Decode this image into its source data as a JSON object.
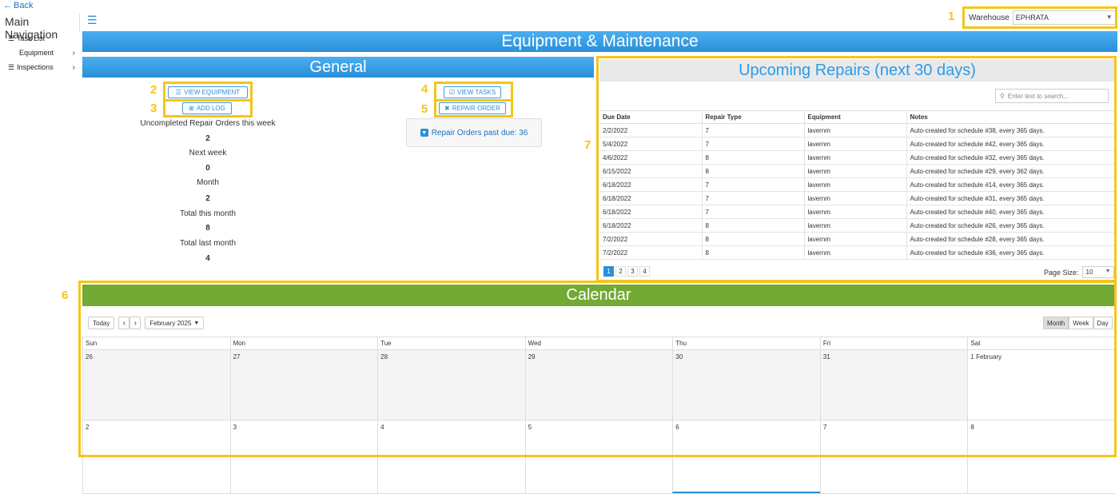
{
  "nav": {
    "back_label": "Back",
    "title": "Main Navigation",
    "items": [
      {
        "label": "Task List"
      },
      {
        "label": "Equipment"
      },
      {
        "label": "Inspections"
      }
    ]
  },
  "warehouse": {
    "label": "Warehouse",
    "value": "EPHRATA"
  },
  "page_title": "Equipment & Maintenance",
  "general": {
    "title": "General",
    "view_equipment": "VIEW EQUIPMENT",
    "add_log": "ADD LOG",
    "view_tasks": "VIEW TASKS",
    "repair_order": "REPAIR ORDER",
    "stats": [
      {
        "label": "Uncompleted Repair Orders this week",
        "value": "2"
      },
      {
        "label": "Next week",
        "value": "0"
      },
      {
        "label": "Month",
        "value": "2"
      },
      {
        "label": "Total this month",
        "value": "8"
      },
      {
        "label": "Total last month",
        "value": "4"
      }
    ],
    "past_due": "Repair Orders past due: 36"
  },
  "repairs": {
    "title": "Upcoming Repairs (next 30 days)",
    "search_placeholder": "Enter text to search...",
    "columns": [
      "Due Date",
      "Repair Type",
      "Equipment",
      "Notes"
    ],
    "rows": [
      [
        "2/2/2022",
        "7",
        "lavernm",
        "Auto-created for schedule #38, every 365 days."
      ],
      [
        "5/4/2022",
        "7",
        "lavernm",
        "Auto-created for schedule #42, every 365 days."
      ],
      [
        "4/6/2022",
        "8",
        "lavernm",
        "Auto-created for schedule #32, every 365 days."
      ],
      [
        "6/15/2022",
        "8",
        "lavernm",
        "Auto-created for schedule #29, every 362 days."
      ],
      [
        "6/18/2022",
        "7",
        "lavernm",
        "Auto-created for schedule #14, every 365 days."
      ],
      [
        "6/18/2022",
        "7",
        "lavernm",
        "Auto-created for schedule #31, every 365 days."
      ],
      [
        "6/18/2022",
        "7",
        "lavernm",
        "Auto-created for schedule #40, every 365 days."
      ],
      [
        "6/18/2022",
        "8",
        "lavernm",
        "Auto-created for schedule #26, every 365 days."
      ],
      [
        "7/2/2022",
        "8",
        "lavernm",
        "Auto-created for schedule #28, every 365 days."
      ],
      [
        "7/2/2022",
        "8",
        "lavernm",
        "Auto-created for schedule #36, every 365 days."
      ]
    ],
    "pages": [
      "1",
      "2",
      "3",
      "4"
    ],
    "page_size_label": "Page Size:",
    "page_size": "10"
  },
  "calendar": {
    "title": "Calendar",
    "today": "Today",
    "month_label": "February 2025",
    "views": [
      "Month",
      "Week",
      "Day"
    ],
    "days": [
      "Sun",
      "Mon",
      "Tue",
      "Wed",
      "Thu",
      "Fri",
      "Sat"
    ],
    "week1": [
      "26",
      "27",
      "28",
      "29",
      "30",
      "31",
      "1 February"
    ],
    "week2": [
      "2",
      "3",
      "4",
      "5",
      "6",
      "7",
      "8"
    ]
  },
  "callouts": [
    "1",
    "2",
    "3",
    "4",
    "5",
    "6",
    "7"
  ],
  "colors": {
    "accent": "#2b8fd9",
    "calendar": "#73a935",
    "highlight": "#f5c518"
  }
}
